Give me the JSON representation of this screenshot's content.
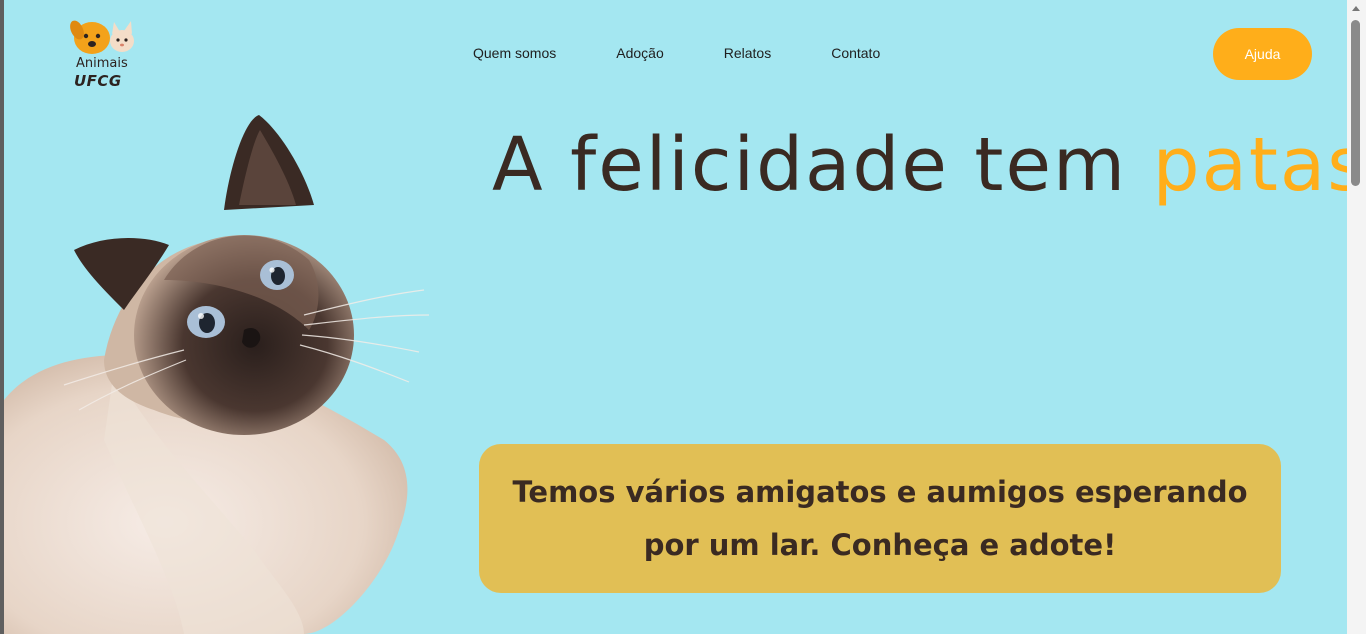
{
  "logo": {
    "line1": "Animais",
    "line2": "UFCG"
  },
  "nav": {
    "items": [
      "Quem somos",
      "Adoção",
      "Relatos",
      "Contato"
    ]
  },
  "header": {
    "help_label": "Ajuda"
  },
  "hero": {
    "title_main": "A felicidade tem ",
    "title_accent": "patas!",
    "message": "Temos vários amigatos e aumigos esperando por um lar. Conheça e adote!"
  },
  "colors": {
    "background": "#a4e7f1",
    "accent": "#ffae1a",
    "box": "#e1bf55",
    "text": "#3a2a22"
  },
  "images": {
    "hero": "siamese-cat-photo",
    "logo": "dog-and-cat-logo-icon"
  }
}
